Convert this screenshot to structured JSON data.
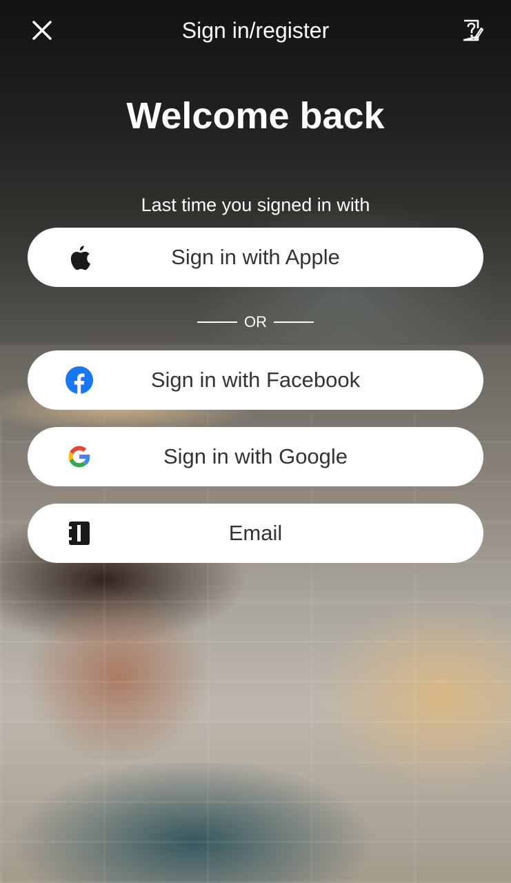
{
  "header": {
    "title": "Sign in/register",
    "close_icon": "close-icon",
    "help_icon": "help-icon"
  },
  "welcome": {
    "headline": "Welcome back",
    "last_time_text": "Last time you signed in with"
  },
  "buttons": {
    "apple": {
      "label": "Sign in with Apple",
      "icon": "apple-icon"
    },
    "facebook": {
      "label": "Sign in with Facebook",
      "icon": "facebook-icon"
    },
    "google": {
      "label": "Sign in with Google",
      "icon": "google-icon"
    },
    "email": {
      "label": "Email",
      "icon": "email-icon"
    }
  },
  "divider": {
    "text": "OR"
  },
  "colors": {
    "button_bg": "#ffffff",
    "button_text": "#333333",
    "facebook_blue": "#1877F2",
    "google_blue": "#4285F4",
    "google_red": "#EA4335",
    "google_yellow": "#FBBC05",
    "google_green": "#34A853"
  }
}
